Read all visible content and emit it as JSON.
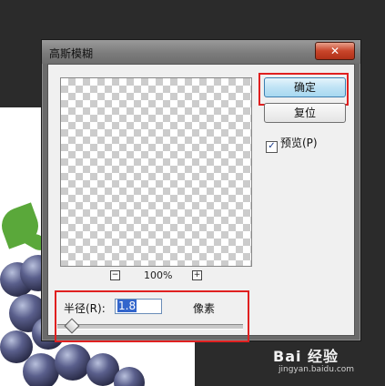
{
  "dialog": {
    "title": "高斯模糊",
    "close_glyph": "✕",
    "ok_label": "确定",
    "reset_label": "复位",
    "preview_label": "预览(P)",
    "preview_checked": true,
    "check_glyph": "✓",
    "zoom": {
      "value": "100%",
      "minus_glyph": "−",
      "plus_glyph": "+"
    },
    "radius": {
      "label": "半径(R):",
      "value": "1.8",
      "unit": "像素"
    }
  },
  "watermark": {
    "logo": "Bai 经验",
    "url": "jingyan.baidu.com"
  },
  "colors": {
    "highlight": "#e02020",
    "ok_button": "#bfe3f5"
  }
}
